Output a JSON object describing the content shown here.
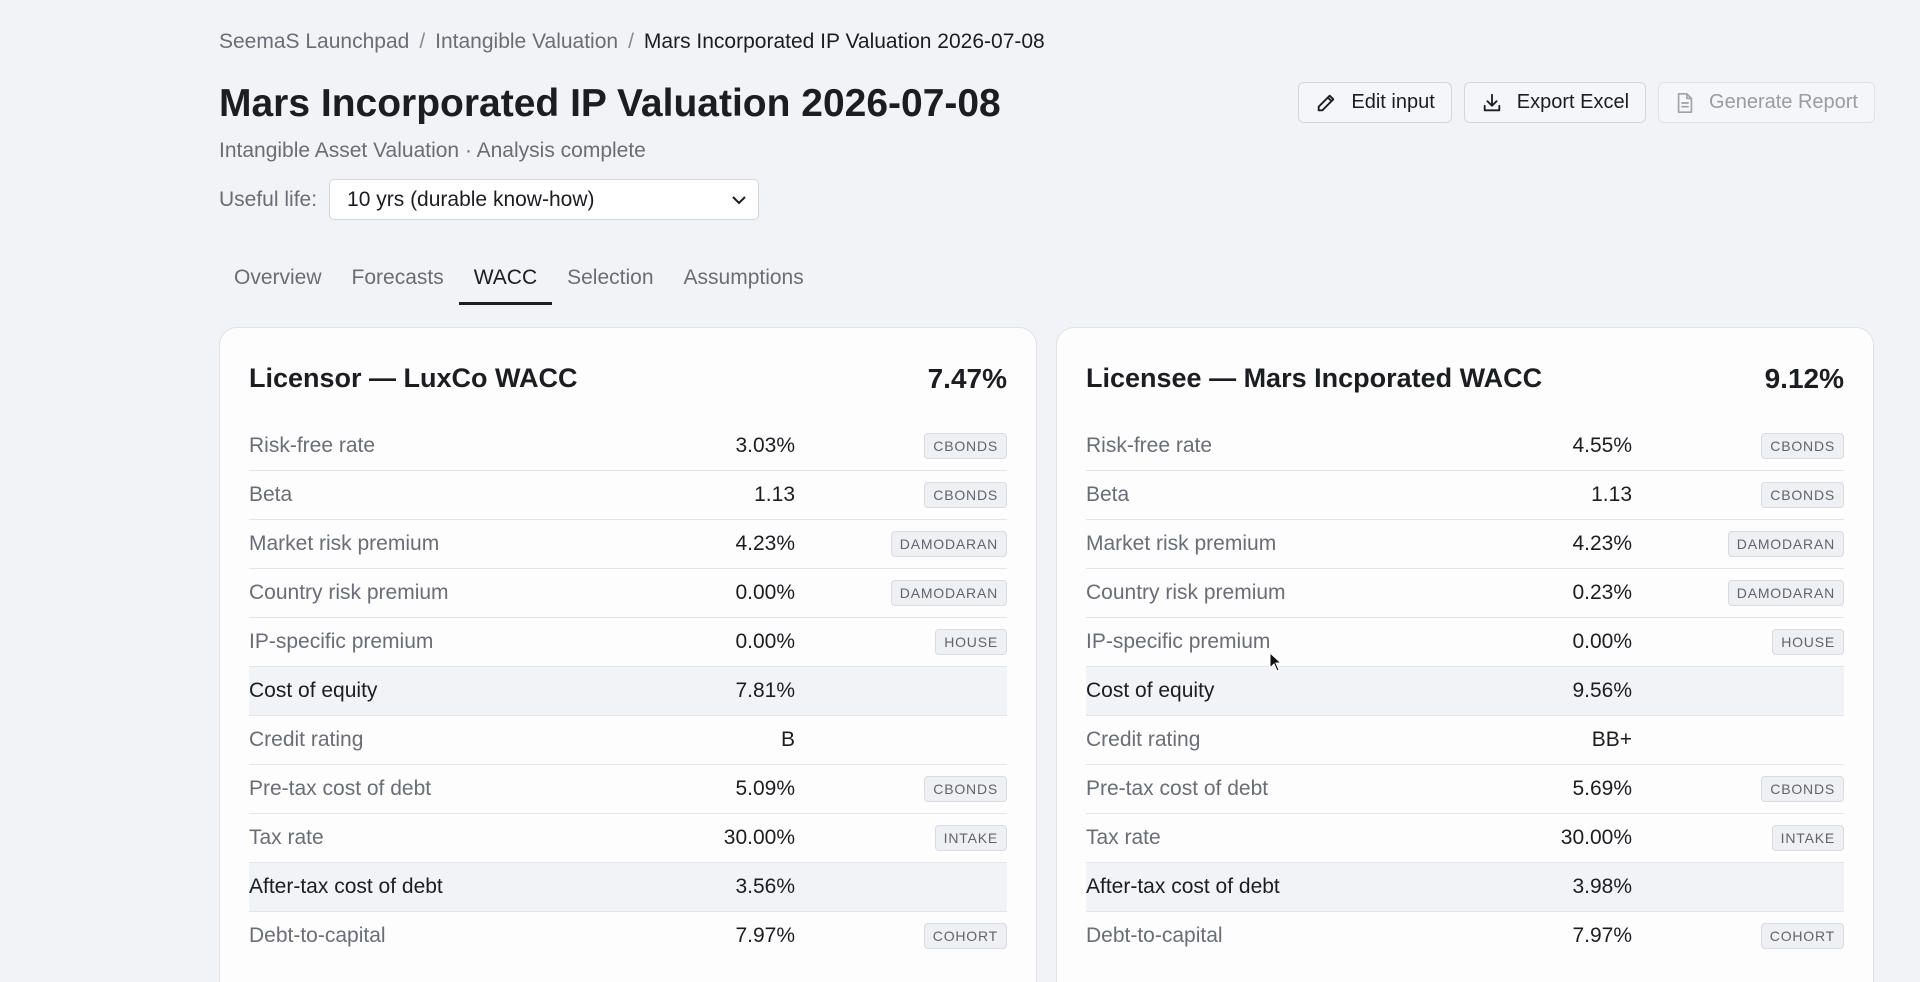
{
  "breadcrumb": [
    "SeemaS Launchpad",
    "Intangible Valuation",
    "Mars Incorporated IP Valuation 2026-07-08"
  ],
  "breadcrumb_sep": "/",
  "title": "Mars Incorporated IP Valuation 2026-07-08",
  "subtitle": "Intangible Asset Valuation · Analysis complete",
  "useful_life": {
    "label": "Useful life:",
    "value": "10 yrs (durable know-how)"
  },
  "actions": {
    "edit": "Edit input",
    "export": "Export Excel",
    "report": "Generate Report"
  },
  "tabs": [
    "Overview",
    "Forecasts",
    "WACC",
    "Selection",
    "Assumptions"
  ],
  "active_tab": "WACC",
  "licensor": {
    "title": "Licensor — LuxCo WACC",
    "wacc": "7.47%",
    "rows": [
      {
        "name": "Risk-free rate",
        "value": "3.03%",
        "source": "CBONDS"
      },
      {
        "name": "Beta",
        "value": "1.13",
        "source": "CBONDS"
      },
      {
        "name": "Market risk premium",
        "value": "4.23%",
        "source": "DAMODARAN"
      },
      {
        "name": "Country risk premium",
        "value": "0.00%",
        "source": "DAMODARAN"
      },
      {
        "name": "IP-specific premium",
        "value": "0.00%",
        "source": "HOUSE"
      },
      {
        "name": "Cost of equity",
        "value": "7.81%",
        "source": ""
      },
      {
        "name": "Credit rating",
        "value": "B",
        "source": ""
      },
      {
        "name": "Pre-tax cost of debt",
        "value": "5.09%",
        "source": "CBONDS"
      },
      {
        "name": "Tax rate",
        "value": "30.00%",
        "source": "INTAKE"
      },
      {
        "name": "After-tax cost of debt",
        "value": "3.56%",
        "source": ""
      },
      {
        "name": "Debt-to-capital",
        "value": "7.97%",
        "source": "COHORT"
      }
    ]
  },
  "licensee": {
    "title": "Licensee — Mars Incporated WACC",
    "wacc": "9.12%",
    "rows": [
      {
        "name": "Risk-free rate",
        "value": "4.55%",
        "source": "CBONDS"
      },
      {
        "name": "Beta",
        "value": "1.13",
        "source": "CBONDS"
      },
      {
        "name": "Market risk premium",
        "value": "4.23%",
        "source": "DAMODARAN"
      },
      {
        "name": "Country risk premium",
        "value": "0.23%",
        "source": "DAMODARAN"
      },
      {
        "name": "IP-specific premium",
        "value": "0.00%",
        "source": "HOUSE"
      },
      {
        "name": "Cost of equity",
        "value": "9.56%",
        "source": ""
      },
      {
        "name": "Credit rating",
        "value": "BB+",
        "source": ""
      },
      {
        "name": "Pre-tax cost of debt",
        "value": "5.69%",
        "source": "CBONDS"
      },
      {
        "name": "Tax rate",
        "value": "30.00%",
        "source": "INTAKE"
      },
      {
        "name": "After-tax cost of debt",
        "value": "3.98%",
        "source": ""
      },
      {
        "name": "Debt-to-capital",
        "value": "7.97%",
        "source": "COHORT"
      }
    ]
  },
  "icons": {
    "edit": "pencil-icon",
    "export": "download-icon",
    "report": "document-icon",
    "select": "chevron-down-icon",
    "cursor": "mouse-pointer-icon"
  }
}
